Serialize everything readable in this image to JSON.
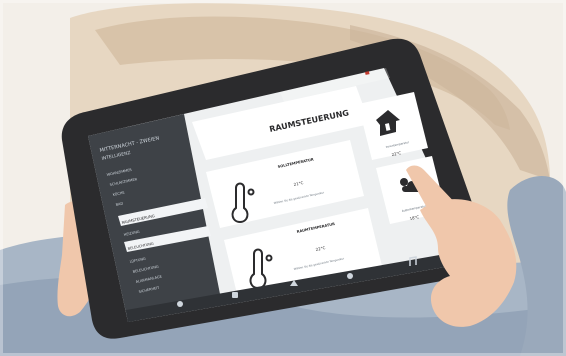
{
  "scene": {
    "description_colors": {
      "room_bg": "#f3efe9",
      "sofa": "#e7d7c2",
      "sofa_shadow": "#cdb79d",
      "tablet_bezel": "#2b2b2d",
      "screen_bg": "#eef0f1",
      "sidebar_bg": "#3e4247",
      "navbar_bg": "#2f3236",
      "accent_red": "#c13a2e",
      "skin": "#f0c7ab",
      "jeans": "#a8b6c6"
    }
  },
  "tablet": {
    "sidebar": {
      "title_lines": [
        "MITTERNACHT - ZWEIEN",
        "INTELLIGENZ"
      ],
      "items": [
        "WOHNZIMMER",
        "SCHLAFZIMMER",
        "KÜCHE",
        "BAD",
        "RAUMSTEUERUNG",
        "HEIZUNG",
        "BELEUCHTUNG",
        "LÜFTUNG",
        "BELEUCHTUNG",
        "ALARMANLAGE",
        "SICHERHEIT"
      ],
      "active_index": 4
    },
    "main": {
      "title": "RAUMSTEUERUNG",
      "cards": [
        {
          "label": "SOLLTEMPERATUR",
          "value": "21°C",
          "hint": "Wählen Sie die gewünschte Temperatur"
        },
        {
          "label": "RAUMTEMPERATUR",
          "value": "22°C",
          "hint": "Wählen Sie die gewünschte Temperatur"
        }
      ],
      "side_cards": [
        {
          "label": "Innentemperatur",
          "value": "22°C",
          "icon": "home-icon"
        },
        {
          "label": "Außentemperatur",
          "value": "18°C",
          "icon": "weather-icon"
        }
      ]
    },
    "navbar": {
      "items": [
        "home-icon",
        "temperature-icon",
        "light-icon",
        "settings-icon",
        "music-icon"
      ]
    }
  }
}
